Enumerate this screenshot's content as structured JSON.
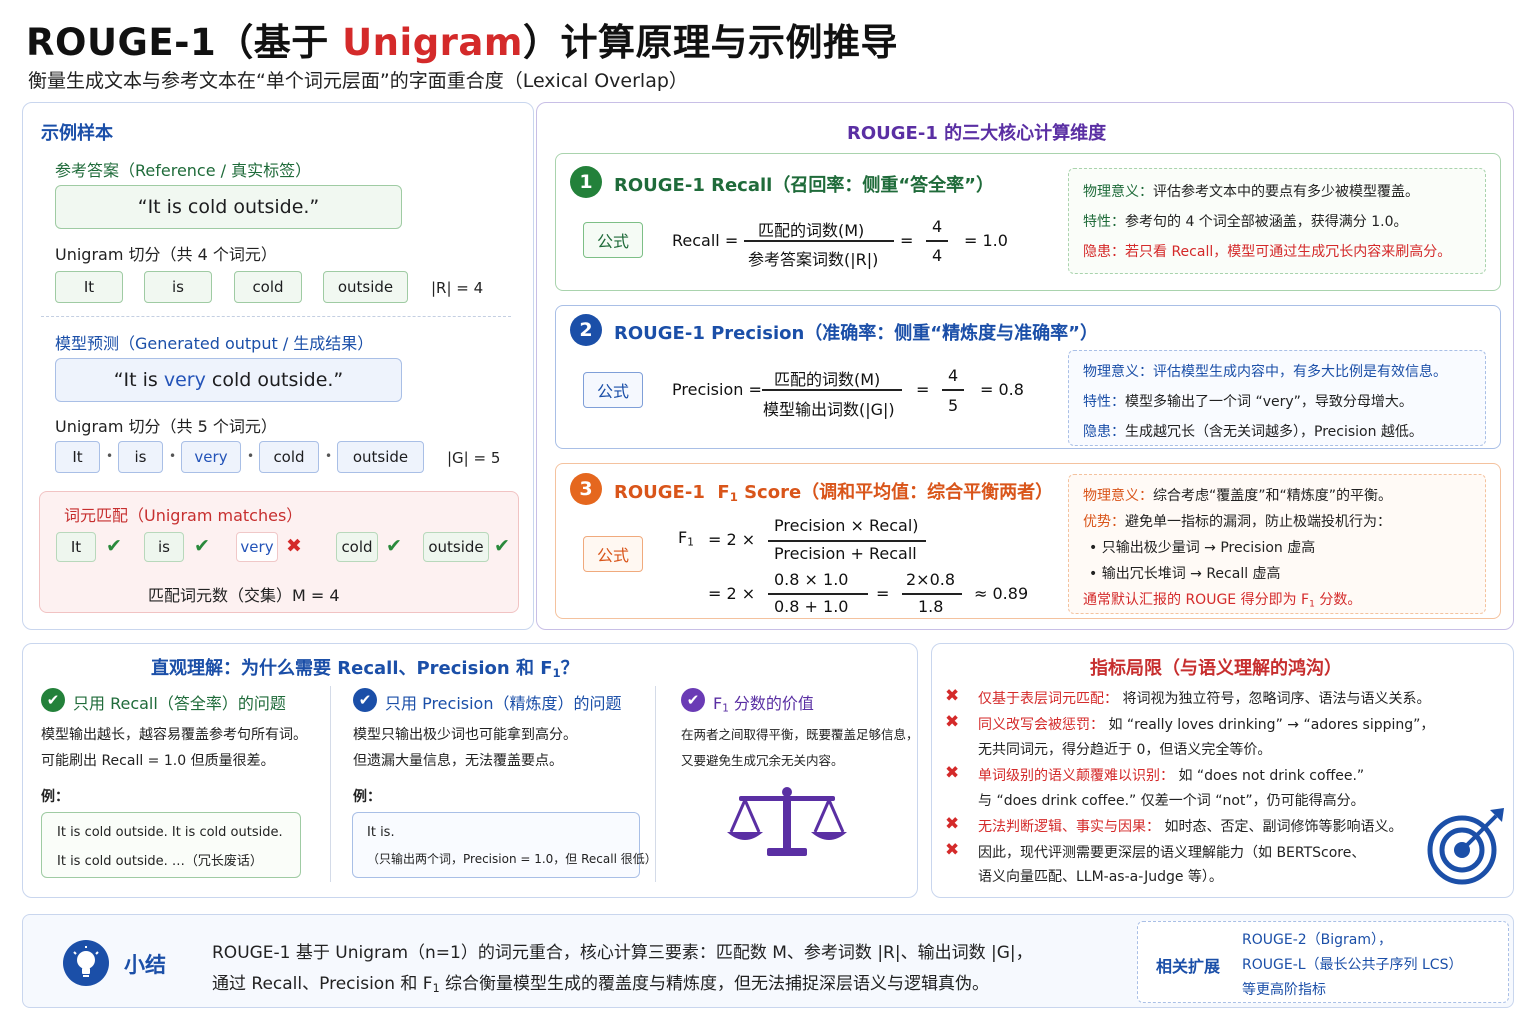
{
  "header": {
    "title_pre": "ROUGE-1（基于 ",
    "title_red": "Unigram",
    "title_post": "）计算原理与示例推导",
    "subtitle": "衡量生成文本与参考文本在“单个词元层面”的字面重合度（Lexical Overlap）"
  },
  "samples": {
    "title": "示例样本",
    "reference": {
      "label": "参考答案（Reference / 真实标签）",
      "sentence": "“It is cold outside.”",
      "split_label": "Unigram 切分（共 4 个词元）",
      "tokens": [
        "It",
        "is",
        "cold",
        "outside"
      ],
      "count": "|R| = 4"
    },
    "generated": {
      "label": "模型预测（Generated output / 生成结果）",
      "sentence_pre": "“It is ",
      "sentence_hl": "very",
      "sentence_post": " cold outside.”",
      "split_label": "Unigram 切分（共 5 个词元）",
      "tokens": [
        "It",
        "is",
        "very",
        "cold",
        "outside"
      ],
      "count": "|G| = 5"
    },
    "matches": {
      "label": "词元匹配（Unigram matches）",
      "tokens": [
        "It",
        "is",
        "very",
        "cold",
        "outside"
      ],
      "marks": [
        "✔",
        "✔",
        "✖",
        "✔",
        "✔"
      ],
      "count": "匹配词元数（交集）M = 4"
    }
  },
  "dims": {
    "title": "ROUGE-1 的三大核心计算维度",
    "formula_label": "公式",
    "recall": {
      "num": "1",
      "heading": "ROUGE-1 Recall（召回率：侧重“答全率”）",
      "lhs": "Recall =",
      "num_text": "匹配的词数(M)",
      "den_text": "参考答案词数(|R|)",
      "eq": "=",
      "frac_num": "4",
      "frac_den": "4",
      "result": "= 1.0",
      "notes": [
        {
          "label": "物理意义：",
          "text": "评估参考文本中的要点有多少被模型覆盖。"
        },
        {
          "label": "特性：",
          "text": "参考句的 4 个词全部被涵盖，获得满分 1.0。"
        },
        {
          "label": "隐患：",
          "text": "若只看 Recall，模型可通过生成冗长内容来刷高分。"
        }
      ]
    },
    "precision": {
      "num": "2",
      "heading": "ROUGE-1 Precision（准确率：侧重“精炼度与准确率”）",
      "lhs": "Precision =",
      "num_text": "匹配的词数(M)",
      "den_text": "模型输出词数(|G|)",
      "eq": "=",
      "frac_num": "4",
      "frac_den": "5",
      "result": "= 0.8",
      "notes": [
        {
          "label": "物理意义：",
          "text": "评估模型生成内容中，有多大比例是有效信息。"
        },
        {
          "label": "特性：",
          "text": "模型多输出了一个词 “very”，导致分母增大。"
        },
        {
          "label": "隐患：",
          "text": "生成越冗长（含无关词越多），Precision 越低。"
        }
      ]
    },
    "f1": {
      "num": "3",
      "heading_pre": "ROUGE-1  F",
      "heading_sub": "1",
      "heading_post": " Score（调和平均值：综合平衡两者）",
      "lhs_f": "F",
      "lhs_sub": "1",
      "eq1": "= 2 ×",
      "num1": "Precision × Recal)",
      "den1": "Precision + Recall",
      "eq2": "= 2 ×",
      "num2": "0.8 × 1.0",
      "den2": "0.8 + 1.0",
      "eq3": "=",
      "num3": "2×0.8",
      "den3": "1.8",
      "result": "≈ 0.89",
      "note1_label": "物理意义：",
      "note1_text": "综合考虑“覆盖度”和“精炼度”的平衡。",
      "note2_label": "优势：",
      "note2_text": "避免单一指标的漏洞，防止极端投机行为：",
      "bullet1": "• 只输出极少量词  →  Precision 虚高",
      "bullet2": "• 输出冗长堆词  →  Recall 虚高",
      "conclusion_pre": "通常默认汇报的 ROUGE 得分即为 F",
      "conclusion_sub": "1",
      "conclusion_post": " 分数。"
    }
  },
  "intuition": {
    "title_pre": "直观理解：为什么需要 Recall、Precision 和 F",
    "title_sub": "1",
    "title_post": "？",
    "col1": {
      "heading": "只用 Recall（答全率）的问题",
      "lines": [
        "模型输出越长，越容易覆盖参考句所有词。",
        "可能刷出 Recall = 1.0 但质量很差。"
      ],
      "ex_label": "例：",
      "ex_lines": [
        "It is cold outside. It is cold outside.",
        "It is cold outside.  …（冗长废话）"
      ]
    },
    "col2": {
      "heading": "只用 Precision（精炼度）的问题",
      "lines": [
        "模型只输出极少词也可能拿到高分。",
        "但遗漏大量信息，无法覆盖要点。"
      ],
      "ex_label": "例：",
      "ex_lines": [
        "It is.",
        "（只输出两个词，Precision = 1.0，但 Recall 很低）"
      ]
    },
    "col3": {
      "heading_pre": "F",
      "heading_sub": "1",
      "heading_post": " 分数的价值",
      "lines": [
        "在两者之间取得平衡，既要覆盖足够信息，",
        "又要避免生成冗余无关内容。"
      ]
    }
  },
  "limits": {
    "title": "指标局限（与语义理解的鸿沟）",
    "items": [
      {
        "red": "仅基于表层词元匹配：",
        "text": " 将词视为独立符号，忽略词序、语法与语义关系。",
        "line2": ""
      },
      {
        "red": "同义改写会被惩罚：",
        "text": " 如 “really loves drinking” → “adores sipping”，",
        "line2": "无共同词元，得分趋近于 0，但语义完全等价。"
      },
      {
        "red": "单词级别的语义颠覆难以识别：",
        "text": " 如 “does not drink coffee.”",
        "line2": "与 “does drink coffee.” 仅差一个词 “not”，仍可能得高分。"
      },
      {
        "red": "无法判断逻辑、事实与因果：",
        "text": " 如时态、否定、副词修饰等影响语义。",
        "line2": ""
      },
      {
        "red": "",
        "text": "因此，现代评测需要更深层的语义理解能力（如 BERTScore、",
        "line2": "语义向量匹配、LLM-as-a-Judge 等）。"
      }
    ]
  },
  "summary": {
    "title": "小结",
    "line1": "ROUGE-1 基于 Unigram（n=1）的词元重合，核心计算三要素：匹配数 M、参考词数 |R|、输出词数 |G|，",
    "line2_pre": "通过 Recall、Precision 和 F",
    "line2_sub": "1",
    "line2_post": " 综合衡量模型生成的覆盖度与精炼度，但无法捕捉深层语义与逻辑真伪。",
    "ext_label": "相关扩展",
    "ext_lines": [
      "ROUGE-2（Bigram），",
      "ROUGE-L（最长公共子序列 LCS）",
      "等更高阶指标"
    ]
  }
}
